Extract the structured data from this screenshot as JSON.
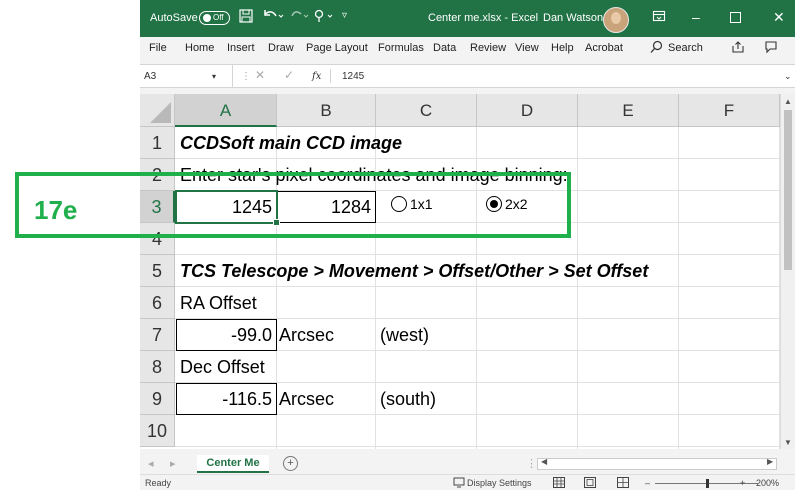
{
  "titlebar": {
    "autosave": "AutoSave",
    "toggle": "Off",
    "filename": "Center me.xlsx - Excel",
    "user": "Dan Watson"
  },
  "menu": [
    "File",
    "Home",
    "Insert",
    "Draw",
    "Page Layout",
    "Formulas",
    "Data",
    "Review",
    "View",
    "Help",
    "Acrobat"
  ],
  "search_label": "Search",
  "formula": {
    "namebox": "A3",
    "fx": "fx",
    "value": "1245"
  },
  "columns": [
    "A",
    "B",
    "C",
    "D",
    "E",
    "F"
  ],
  "rows": [
    "1",
    "2",
    "3",
    "4",
    "5",
    "6",
    "7",
    "8",
    "9",
    "10"
  ],
  "cells": {
    "r1": "CCDSoft main CCD image",
    "r2": "Enter star's pixel coordinates and image binning:",
    "a3": "1245",
    "b3": "1284",
    "radio1": "1x1",
    "radio2": "2x2",
    "r5": "TCS Telescope > Movement > Offset/Other > Set Offset",
    "r6": "RA Offset",
    "a7": "-99.0",
    "b7": "Arcsec",
    "c7": "(west)",
    "r8": "Dec Offset",
    "a9": "-116.5",
    "b9": "Arcsec",
    "c9": "(south)"
  },
  "radio_selected": "2x2",
  "sheet_tab": "Center Me",
  "status": {
    "ready": "Ready",
    "display_settings": "Display Settings",
    "zoom": "200%"
  },
  "annotation": {
    "label": "17e",
    "color": "#20b04b"
  },
  "colors": {
    "excel_green": "#217346"
  }
}
